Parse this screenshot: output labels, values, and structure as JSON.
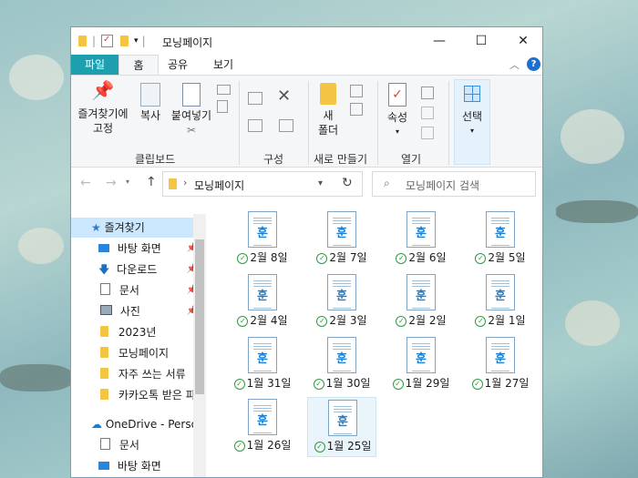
{
  "window": {
    "title": "모닝페이지"
  },
  "title_controls": {
    "minimize": "—",
    "maximize": "☐",
    "close": "✕"
  },
  "tabs": {
    "file": "파일",
    "home": "홈",
    "share": "공유",
    "view": "보기"
  },
  "ribbon": {
    "pin_quick_access": "즐겨찾기에\n고정",
    "pin_line1": "즐겨찾기에",
    "pin_line2": "고정",
    "copy": "복사",
    "paste": "붙여넣기",
    "clipboard_group": "클립보드",
    "organize_group": "구성",
    "new_folder_line1": "새",
    "new_folder_line2": "폴더",
    "new_group": "새로 만들기",
    "properties": "속성",
    "open_group": "열기",
    "select": "선택"
  },
  "address": {
    "path": "모닝페이지"
  },
  "search": {
    "placeholder": "모닝페이지 검색"
  },
  "nav": {
    "quick_access": "즐겨찾기",
    "items": [
      {
        "label": "바탕 화면"
      },
      {
        "label": "다운로드"
      },
      {
        "label": "문서"
      },
      {
        "label": "사진"
      },
      {
        "label": "2023년"
      },
      {
        "label": "모닝페이지"
      },
      {
        "label": "자주 쓰는 서류"
      },
      {
        "label": "카카오톡 받은 파"
      }
    ],
    "onedrive": "OneDrive - Perso",
    "onedrive_items": [
      {
        "label": "문서"
      },
      {
        "label": "바탕 화면"
      }
    ]
  },
  "files": [
    {
      "name": "2월 8일"
    },
    {
      "name": "2월 7일"
    },
    {
      "name": "2월 6일"
    },
    {
      "name": "2월 5일"
    },
    {
      "name": "2월 4일"
    },
    {
      "name": "2월 3일"
    },
    {
      "name": "2월 2일"
    },
    {
      "name": "2월 1일"
    },
    {
      "name": "1월 31일"
    },
    {
      "name": "1월 30일"
    },
    {
      "name": "1월 29일"
    },
    {
      "name": "1월 27일"
    },
    {
      "name": "1월 26일"
    },
    {
      "name": "1월 25일"
    }
  ],
  "file_icon_glyph": "훈",
  "colors": {
    "file_tab": "#1e9fb0",
    "selection": "#cce8ff",
    "sync_ok": "#2e9a3c"
  }
}
